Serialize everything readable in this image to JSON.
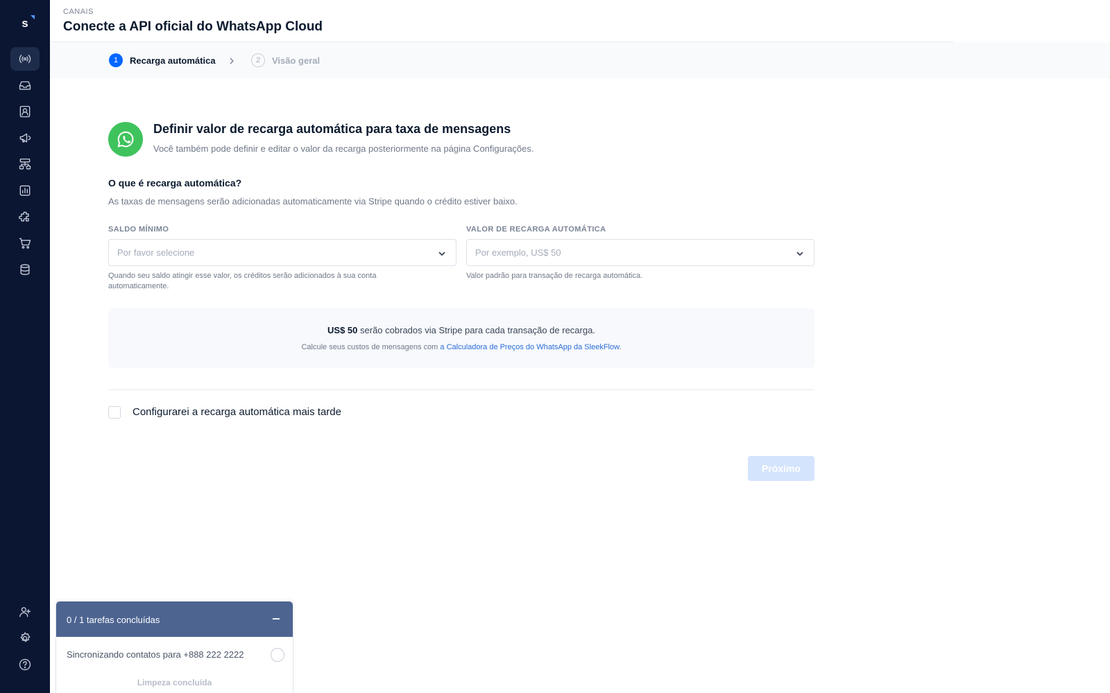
{
  "sidebar": {
    "logo": "s",
    "items": [
      {
        "name": "channels",
        "icon": "broadcast-icon",
        "active": true
      },
      {
        "name": "inbox",
        "icon": "inbox-icon",
        "active": false
      },
      {
        "name": "contacts",
        "icon": "contact-card-icon",
        "active": false
      },
      {
        "name": "broadcasts",
        "icon": "megaphone-icon",
        "active": false
      },
      {
        "name": "flows",
        "icon": "flow-builder-icon",
        "active": false
      },
      {
        "name": "analytics",
        "icon": "chart-icon",
        "active": false
      },
      {
        "name": "integrations",
        "icon": "puzzle-icon",
        "active": false
      },
      {
        "name": "commerce",
        "icon": "cart-icon",
        "active": false
      },
      {
        "name": "data",
        "icon": "database-icon",
        "active": false
      },
      {
        "name": "invite-users",
        "icon": "add-user-icon",
        "active": false
      },
      {
        "name": "settings",
        "icon": "gear-icon",
        "active": false
      },
      {
        "name": "help",
        "icon": "help-icon",
        "active": false
      }
    ]
  },
  "header": {
    "breadcrumb": "CANAIS",
    "title": "Conecte a API oficial do WhatsApp Cloud"
  },
  "stepper": {
    "steps": [
      {
        "number": "1",
        "label": "Recarga automática",
        "active": true
      },
      {
        "number": "2",
        "label": "Visão geral",
        "active": false
      }
    ]
  },
  "main": {
    "title": "Definir valor de recarga automática para taxa de mensagens",
    "subtitle": "Você também pode definir e editar o valor da recarga posteriormente na página Configurações.",
    "question": "O que é recarga automática?",
    "question_desc": "As taxas de mensagens serão adicionadas automaticamente via Stripe quando o crédito estiver baixo.",
    "min_balance": {
      "label": "SALDO MÍNIMO",
      "placeholder": "Por favor selecione",
      "help": "Quando seu saldo atingir esse valor, os créditos serão adicionados à sua conta automaticamente."
    },
    "topup_value": {
      "label": "VALOR DE RECARGA AUTOMÁTICA",
      "placeholder": "Por exemplo, US$ 50",
      "help": "Valor padrão para transação de recarga automática."
    },
    "info": {
      "amount": "US$ 50",
      "line1_rest": " serão cobrados via Stripe para cada transação de recarga.",
      "line2_prefix": "Calcule seus custos de mensagens com ",
      "line2_link": "a Calculadora de Preços do WhatsApp da SleekFlow",
      "line2_suffix": "."
    },
    "checkbox_label": "Configurarei a recarga automática mais tarde",
    "checkbox_checked": false,
    "next_button": "Próximo"
  },
  "task_panel": {
    "header": "0 / 1 tarefas concluídas",
    "item": "Sincronizando contatos para +888 222 2222",
    "footer": "Limpeza concluída"
  },
  "colors": {
    "sidebar_bg": "#0b1633",
    "primary": "#0066ff",
    "whatsapp": "#3fc35d",
    "task_header": "#4d6491",
    "link": "#2a6dd9"
  }
}
